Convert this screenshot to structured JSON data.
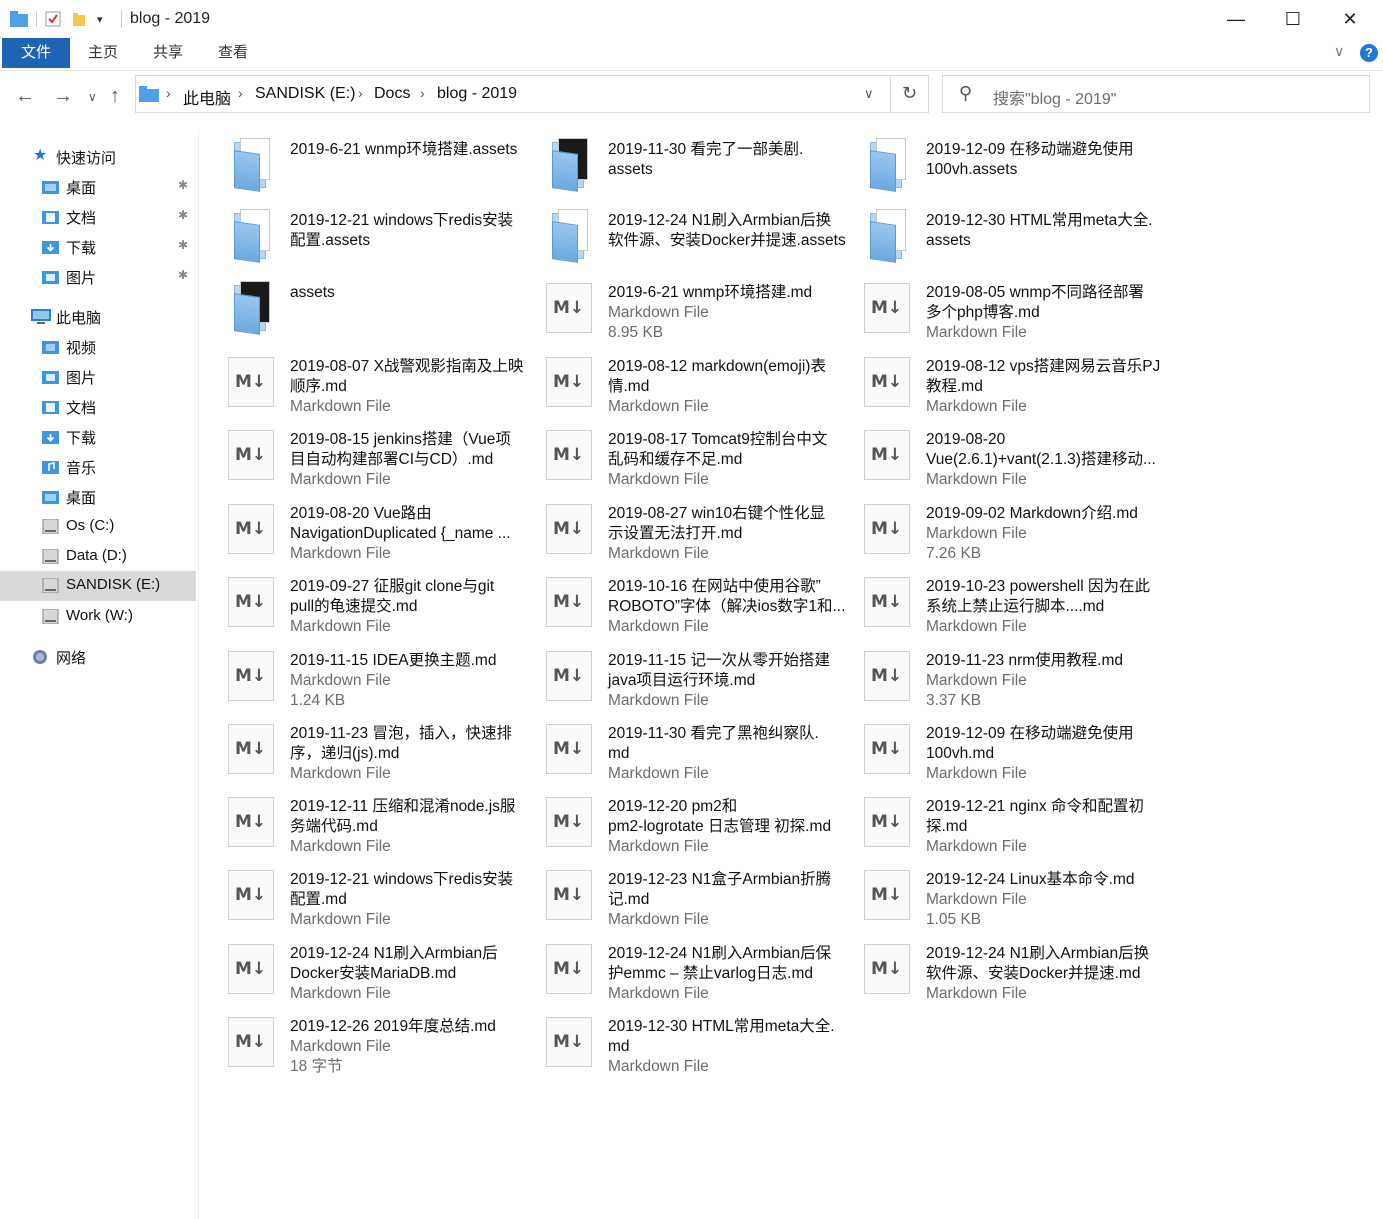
{
  "window": {
    "title": "blog - 2019",
    "minimize": "—",
    "maximize": "☐",
    "close": "✕",
    "qa_dropdown": "▾"
  },
  "ribbon": {
    "tabs": [
      "文件",
      "主页",
      "共享",
      "查看"
    ],
    "expand_icon": "∨",
    "help_icon": "?"
  },
  "nav": {
    "back": "←",
    "forward": "→",
    "recent": "∨",
    "up": "↑",
    "breadcrumb": [
      "此电脑",
      "SANDISK (E:)",
      "Docs",
      "blog - 2019"
    ],
    "sep": "›",
    "dropdown": "∨",
    "refresh": "↻",
    "search_placeholder": "搜索\"blog - 2019\"",
    "search_icon": "⚲"
  },
  "sidebar": {
    "quick_access": "快速访问",
    "quick_items": [
      "桌面",
      "文档",
      "下载",
      "图片"
    ],
    "this_pc": "此电脑",
    "pc_items": [
      "视频",
      "图片",
      "文档",
      "下载",
      "音乐",
      "桌面"
    ],
    "drives": [
      "Os (C:)",
      "Data (D:)",
      "SANDISK (E:)",
      "Work (W:)"
    ],
    "network": "网络",
    "pin": "📌"
  },
  "files": [
    {
      "name": "2019-6-21 wnmp环境搭建.assets",
      "type": "folder"
    },
    {
      "name": "2019-11-30 看完了一部美剧.\nassets",
      "type": "folder-dark"
    },
    {
      "name": "2019-12-09 在移动端避免使用\n100vh.assets",
      "type": "folder"
    },
    {
      "name": "2019-12-21 windows下redis安装\n配置.assets",
      "type": "folder"
    },
    {
      "name": "2019-12-24 N1刷入Armbian后换\n软件源、安装Docker并提速.assets",
      "type": "folder"
    },
    {
      "name": "2019-12-30 HTML常用meta大全.\nassets",
      "type": "folder"
    },
    {
      "name": "assets",
      "type": "folder-dark"
    },
    {
      "name": "2019-6-21 wnmp环境搭建.md",
      "sub1": "Markdown File",
      "sub2": "8.95 KB",
      "type": "md"
    },
    {
      "name": "2019-08-05 wnmp不同路径部署\n多个php博客.md",
      "sub1": "Markdown File",
      "type": "md"
    },
    {
      "name": "2019-08-07 X战警观影指南及上映\n顺序.md",
      "sub1": "Markdown File",
      "type": "md"
    },
    {
      "name": "2019-08-12 markdown(emoji)表\n情.md",
      "sub1": "Markdown File",
      "type": "md"
    },
    {
      "name": "2019-08-12 vps搭建网易云音乐PJ\n教程.md",
      "sub1": "Markdown File",
      "type": "md"
    },
    {
      "name": "2019-08-15 jenkins搭建（Vue项\n目自动构建部署CI与CD）.md",
      "sub1": "Markdown File",
      "type": "md"
    },
    {
      "name": "2019-08-17 Tomcat9控制台中文\n乱码和缓存不足.md",
      "sub1": "Markdown File",
      "type": "md"
    },
    {
      "name": "2019-08-20\nVue(2.6.1)+vant(2.1.3)搭建移动...",
      "sub1": "Markdown File",
      "type": "md"
    },
    {
      "name": "2019-08-20 Vue路由\nNavigationDuplicated {_name ...",
      "sub1": "Markdown File",
      "type": "md"
    },
    {
      "name": "2019-08-27 win10右键个性化显\n示设置无法打开.md",
      "sub1": "Markdown File",
      "type": "md"
    },
    {
      "name": "2019-09-02 Markdown介绍.md",
      "sub1": "Markdown File",
      "sub2": "7.26 KB",
      "type": "md"
    },
    {
      "name": "2019-09-27 征服git clone与git\npull的龟速提交.md",
      "sub1": "Markdown File",
      "type": "md"
    },
    {
      "name": "2019-10-16 在网站中使用谷歌”\nROBOTO”字体（解决ios数字1和...",
      "sub1": "Markdown File",
      "type": "md"
    },
    {
      "name": "2019-10-23 powershell 因为在此\n系统上禁止运行脚本....md",
      "sub1": "Markdown File",
      "type": "md"
    },
    {
      "name": "2019-11-15 IDEA更换主题.md",
      "sub1": "Markdown File",
      "sub2": "1.24 KB",
      "type": "md"
    },
    {
      "name": "2019-11-15 记一次从零开始搭建\njava项目运行环境.md",
      "sub1": "Markdown File",
      "type": "md"
    },
    {
      "name": "2019-11-23 nrm使用教程.md",
      "sub1": "Markdown File",
      "sub2": "3.37 KB",
      "type": "md"
    },
    {
      "name": "2019-11-23 冒泡，插入，快速排\n序，递归(js).md",
      "sub1": "Markdown File",
      "type": "md"
    },
    {
      "name": "2019-11-30 看完了黑袍纠察队.\nmd",
      "sub1": "Markdown File",
      "type": "md"
    },
    {
      "name": "2019-12-09 在移动端避免使用\n100vh.md",
      "sub1": "Markdown File",
      "type": "md"
    },
    {
      "name": "2019-12-11 压缩和混淆node.js服\n务端代码.md",
      "sub1": "Markdown File",
      "type": "md"
    },
    {
      "name": "2019-12-20 pm2和\npm2-logrotate 日志管理 初探.md",
      "sub1": "Markdown File",
      "type": "md"
    },
    {
      "name": "2019-12-21 nginx 命令和配置初\n探.md",
      "sub1": "Markdown File",
      "type": "md"
    },
    {
      "name": "2019-12-21 windows下redis安装\n配置.md",
      "sub1": "Markdown File",
      "type": "md"
    },
    {
      "name": "2019-12-23 N1盒子Armbian折腾\n记.md",
      "sub1": "Markdown File",
      "type": "md"
    },
    {
      "name": "2019-12-24 Linux基本命令.md",
      "sub1": "Markdown File",
      "sub2": "1.05 KB",
      "type": "md"
    },
    {
      "name": "2019-12-24 N1刷入Armbian后\nDocker安装MariaDB.md",
      "sub1": "Markdown File",
      "type": "md"
    },
    {
      "name": "2019-12-24 N1刷入Armbian后保\n护emmc – 禁止varlog日志.md",
      "sub1": "Markdown File",
      "type": "md"
    },
    {
      "name": "2019-12-24 N1刷入Armbian后换\n软件源、安装Docker并提速.md",
      "sub1": "Markdown File",
      "type": "md"
    },
    {
      "name": "2019-12-26 2019年度总结.md",
      "sub1": "Markdown File",
      "sub2": "18 字节",
      "type": "md"
    },
    {
      "name": "2019-12-30 HTML常用meta大全.\nmd",
      "sub1": "Markdown File",
      "type": "md"
    }
  ],
  "md_icon_text": "M↓"
}
